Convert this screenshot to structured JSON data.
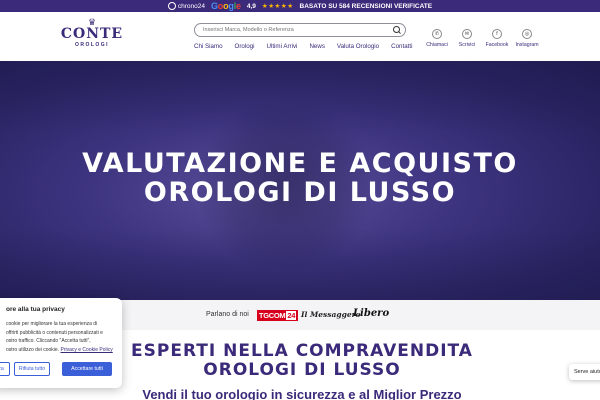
{
  "topbar": {
    "chrono_label": "chrono24",
    "google_label": "Google",
    "rating": "4,9",
    "stars": "★★★★★",
    "reviews_text": "BASATO SU 584 RECENSIONI VERIFICATE"
  },
  "header": {
    "logo": {
      "crown": "♛",
      "brand": "CONTE",
      "sub": "OROLOGI"
    },
    "search": {
      "placeholder": "Inserisci Marca, Modello o Referenza"
    },
    "nav": [
      "Chi Siamo",
      "Orologi",
      "Ultimi Arrivi",
      "News",
      "Valuta Orologio",
      "Contatti"
    ],
    "social": [
      {
        "label": "Chiamaci",
        "icon": "phone-icon",
        "glyph": "✆"
      },
      {
        "label": "Scrivici",
        "icon": "mail-icon",
        "glyph": "✉"
      },
      {
        "label": "Facebook",
        "icon": "facebook-icon",
        "glyph": "f"
      },
      {
        "label": "Instagram",
        "icon": "instagram-icon",
        "glyph": "◎"
      }
    ]
  },
  "hero": {
    "line1": "VALUTAZIONE E ACQUISTO",
    "line2": "OROLOGI DI LUSSO"
  },
  "press": {
    "label": "Parlano di noi",
    "tgcom": "TGCOM",
    "tgcom_num": "24",
    "messaggero": "Il Messaggero",
    "libero": "Libero"
  },
  "section": {
    "title_line1": "ESPERTI NELLA COMPRAVENDITA",
    "title_line2": "OROLOGI DI LUSSO",
    "subtitle": "Vendi il tuo orologio in sicurezza e al Miglior Prezzo"
  },
  "cookie": {
    "title": "ore alla tua privacy",
    "body_lines": [
      "cookie per migliorare la tua esperienza di",
      "offrirti pubblicità o contenuti personalizzati e",
      "ostro traffico. Cliccando \"Accetta tutti\",",
      "ostro utilizzo dei cookie."
    ],
    "policy_link": "Privacy e Cookie Policy",
    "customize_label": "za",
    "reject_label": "Rifiuta tutto",
    "accept_label": "Accettare tutti"
  },
  "help": {
    "label": "Serve aiuto?"
  },
  "colors": {
    "brand_purple": "#3b2a7a",
    "cookie_blue": "#3b5fd9",
    "tgcom_red": "#d6001c"
  }
}
